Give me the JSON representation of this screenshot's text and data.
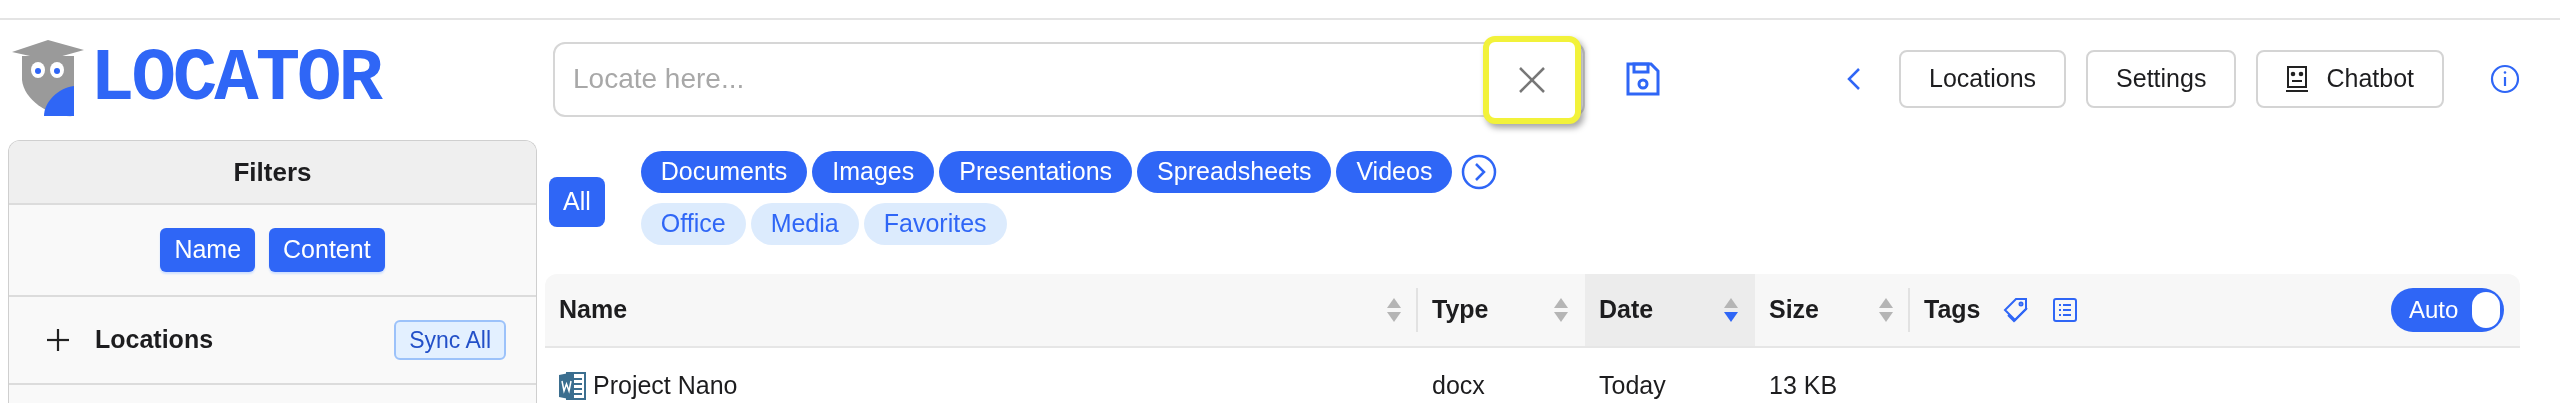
{
  "logo": {
    "text": "LOCATOR"
  },
  "search": {
    "placeholder": "Locate here...",
    "clear_highlighted": true
  },
  "nav": {
    "buttons": [
      {
        "label": "Locations",
        "kind": "plain"
      },
      {
        "label": "Settings",
        "kind": "plain"
      },
      {
        "label": "Chatbot",
        "kind": "chatbot"
      }
    ]
  },
  "filters": {
    "title": "Filters",
    "modes": [
      {
        "label": "Name",
        "selected": true
      },
      {
        "label": "Content",
        "selected": true
      }
    ],
    "locations": {
      "label": "Locations",
      "expanded": false,
      "sync_label": "Sync All"
    }
  },
  "categories": {
    "all": {
      "label": "All",
      "selected": true
    },
    "chips": [
      {
        "label": "Documents",
        "selected": true
      },
      {
        "label": "Images",
        "selected": true
      },
      {
        "label": "Presentations",
        "selected": true
      },
      {
        "label": "Spreadsheets",
        "selected": true
      },
      {
        "label": "Videos",
        "selected": true
      },
      {
        "label": "Office",
        "selected": false
      },
      {
        "label": "Media",
        "selected": false
      },
      {
        "label": "Favorites",
        "selected": false
      }
    ]
  },
  "table": {
    "columns": [
      {
        "label": "Name",
        "kind": "sortable",
        "sorted": false
      },
      {
        "label": "Type",
        "kind": "sortable",
        "sorted": false
      },
      {
        "label": "Date",
        "kind": "sortable",
        "sorted": true
      },
      {
        "label": "Size",
        "kind": "sortable",
        "sorted": false
      },
      {
        "label": "Tags",
        "kind": "tags"
      }
    ],
    "auto": {
      "label": "Auto",
      "on": true
    },
    "rows": [
      {
        "cells": [
          "Project Nano",
          "docx",
          "Today",
          "13 KB"
        ]
      }
    ]
  }
}
